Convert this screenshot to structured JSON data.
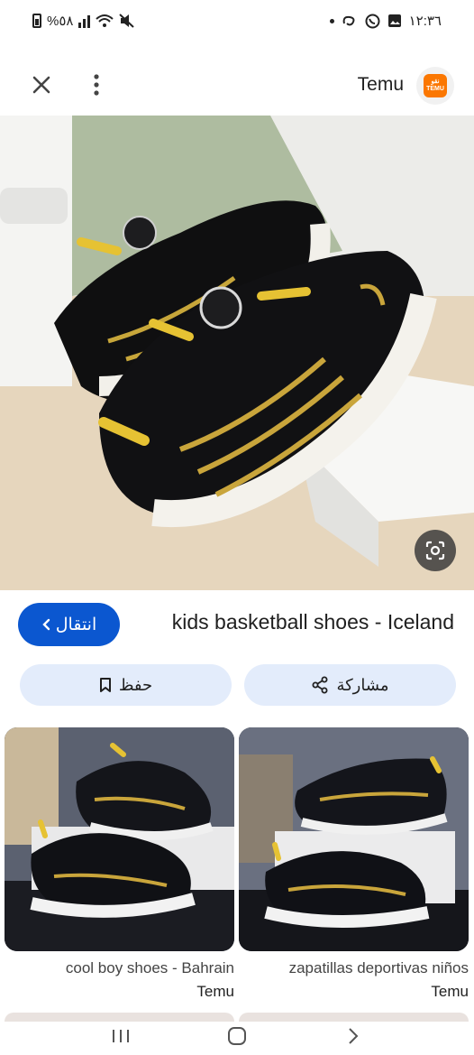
{
  "status_bar": {
    "battery_percent": "%٥٨",
    "time": "١٢:٣٦"
  },
  "top_bar": {
    "site_name": "Temu",
    "logo_text_top": "نقو",
    "logo_text_bottom": "TEMU"
  },
  "result": {
    "visit_label": "انتقال",
    "title": "kids basketball shoes - Iceland",
    "save_label": "حفظ",
    "share_label": "مشاركة"
  },
  "related": [
    {
      "caption": "cool boy shoes - Bahrain",
      "source": "Temu"
    },
    {
      "caption": "zapatillas deportivas niños",
      "source": "Temu"
    }
  ],
  "colors": {
    "accent": "#0b57d0",
    "pill_bg": "#e3ecfb",
    "brand": "#fb7701"
  },
  "icons": {
    "close": "close-icon",
    "menu": "more-vert-icon",
    "lens": "lens-icon",
    "bookmark": "bookmark-icon",
    "share": "share-icon",
    "chevron": "chevron-left-icon",
    "nav_recents": "recents-icon",
    "nav_home": "home-icon",
    "nav_back": "back-icon"
  }
}
